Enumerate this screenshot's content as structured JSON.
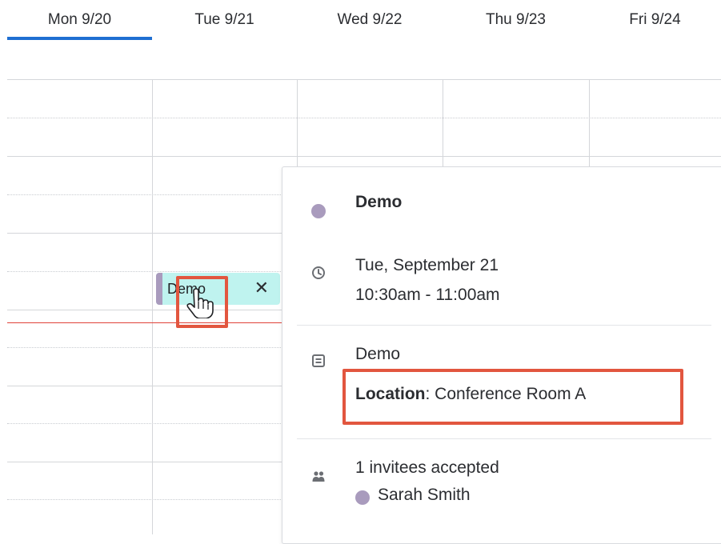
{
  "header": {
    "days": [
      {
        "label": "Mon 9/20",
        "active": true
      },
      {
        "label": "Tue 9/21",
        "active": false
      },
      {
        "label": "Wed 9/22",
        "active": false
      },
      {
        "label": "Thu 9/23",
        "active": false
      },
      {
        "label": "Fri 9/24",
        "active": false
      }
    ]
  },
  "event_chip": {
    "title": "Demo",
    "close_label": "✕"
  },
  "popover": {
    "title": "Demo",
    "date_line": "Tue, September 21",
    "time_line": "10:30am - 11:00am",
    "description": "Demo",
    "location_label": "Location",
    "location_value": ": Conference Room A",
    "invitees_summary": "1 invitees accepted",
    "invitee_name": "Sarah Smith"
  },
  "colors": {
    "accent": "#1f6fd2",
    "event_bg": "#bff3ef",
    "event_bar": "#a99bbd",
    "now_line": "#e0433a",
    "highlight": "#e2563f"
  },
  "icons": {
    "color_dot": "color-dot-icon",
    "clock": "clock-icon",
    "description": "description-icon",
    "invitees": "people-icon",
    "cursor": "hand-pointer-icon"
  }
}
